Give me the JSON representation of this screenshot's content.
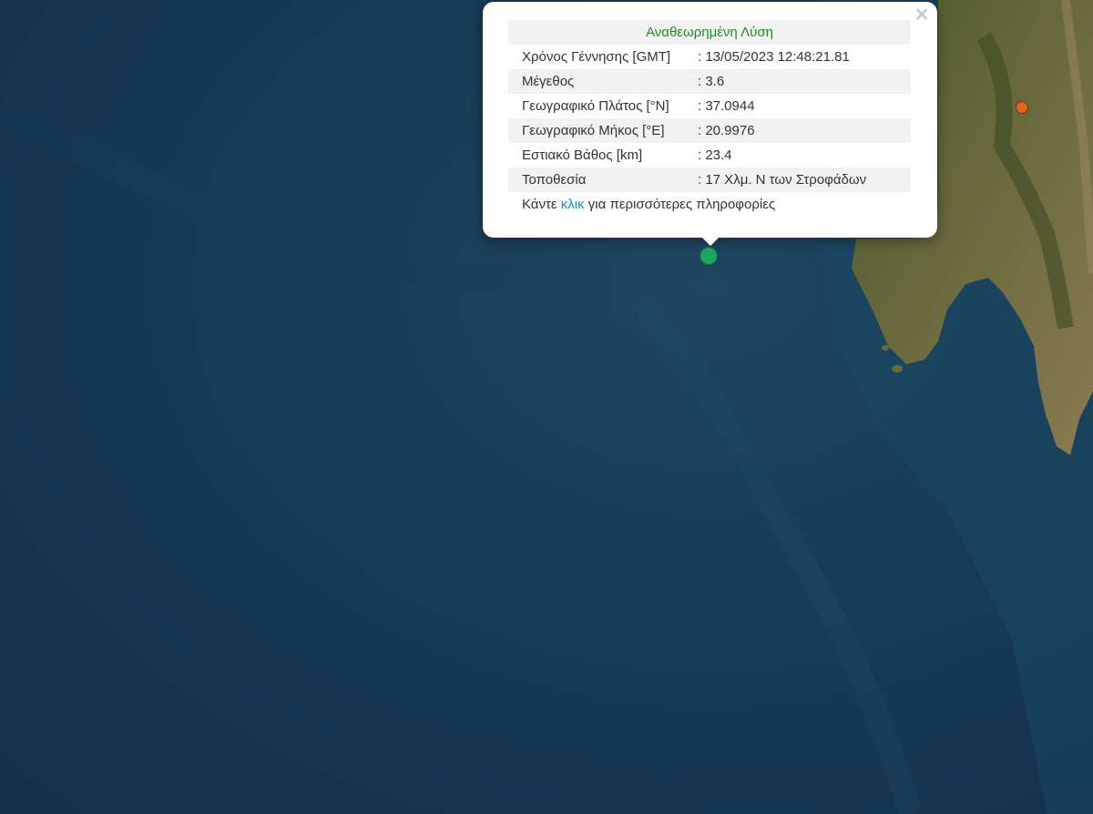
{
  "popup": {
    "title": "Αναθεωρημένη Λύση",
    "close_icon": "close-icon",
    "rows": [
      {
        "label": "Χρόνος Γέννησης [GMT]",
        "value": ": 13/05/2023 12:48:21.81"
      },
      {
        "label": "Μέγεθος",
        "value": ": 3.6"
      },
      {
        "label": "Γεωγραφικό Πλάτος [°N]",
        "value": ": 37.0944"
      },
      {
        "label": "Γεωγραφικό Μήκος [°E]",
        "value": ": 20.9976"
      },
      {
        "label": "Εστιακό Βάθος [km]",
        "value": ": 23.4"
      },
      {
        "label": "Τοποθεσία",
        "value": ": 17 Χλμ. Ν των Στροφάδων"
      }
    ],
    "more_prefix": "Κάντε ",
    "more_link": "κλικ",
    "more_suffix": " για περισσότερες πληροφορίες"
  },
  "markers": {
    "selected_color": "#1fa363",
    "other_color": "#e0661b"
  }
}
